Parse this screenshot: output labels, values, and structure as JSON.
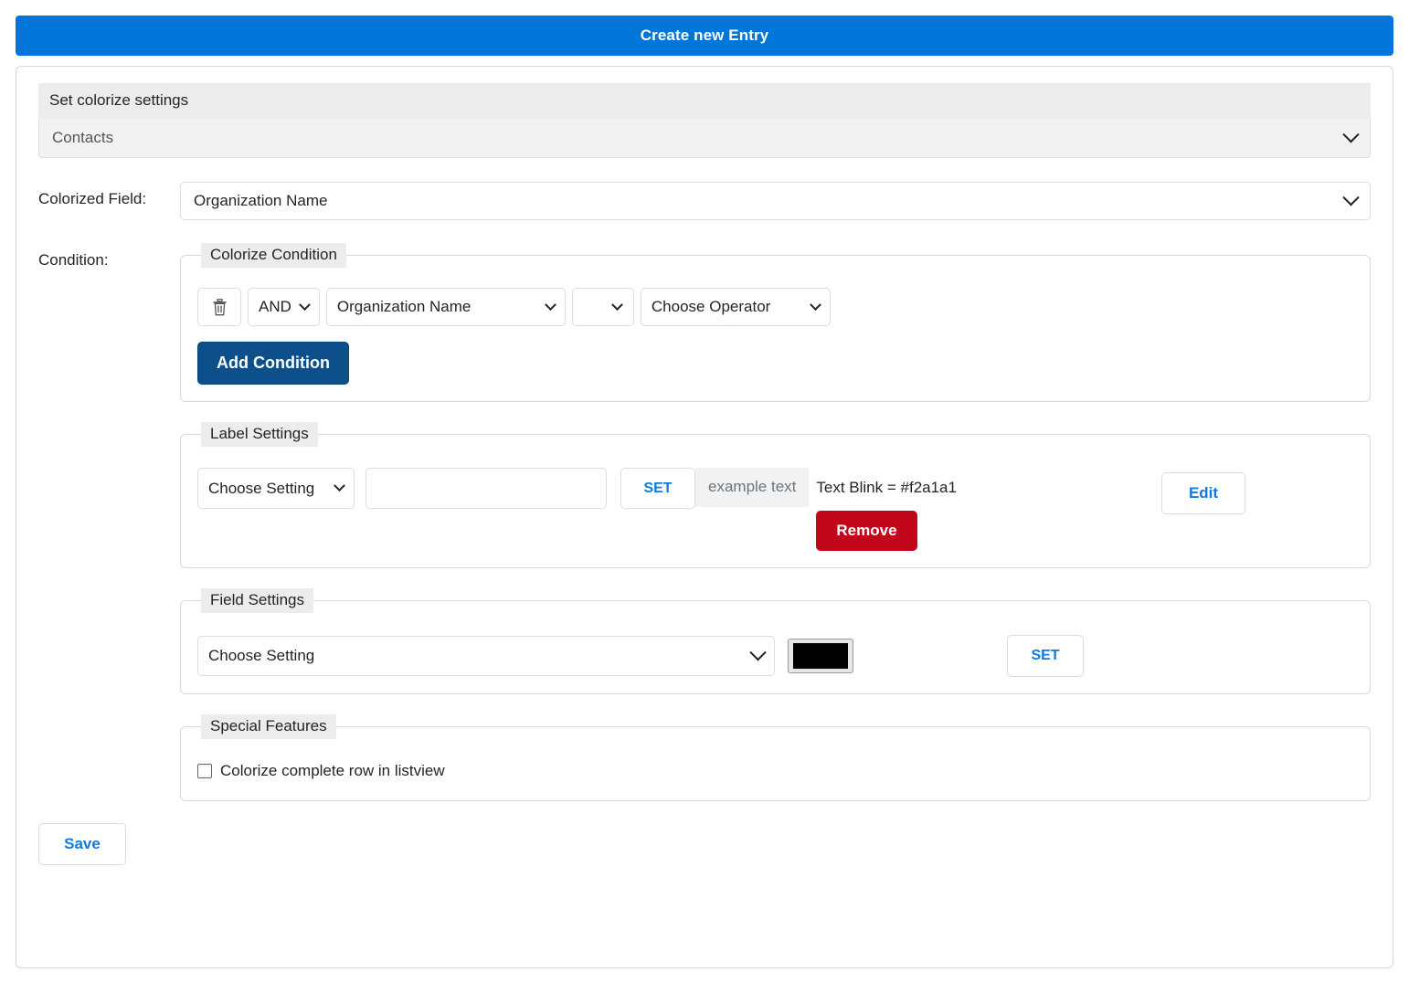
{
  "header": {
    "title": "Create new Entry"
  },
  "module_panel": {
    "heading": "Set colorize settings",
    "selected_module": "Contacts"
  },
  "colorized_field": {
    "label": "Colorized Field:",
    "value": "Organization Name"
  },
  "condition": {
    "label": "Condition:",
    "legend": "Colorize Condition",
    "row": {
      "delete_icon": "trash-icon",
      "logic": "AND",
      "field": "Organization Name",
      "subfield": "",
      "operator": "Choose Operator"
    },
    "add_button": "Add Condition"
  },
  "label_settings": {
    "legend": "Label Settings",
    "setting_select": "Choose Setting",
    "value_input": "",
    "value_placeholder": "",
    "set_button": "SET",
    "example_text": "example text",
    "applied_rule": "Text Blink = #f2a1a1",
    "remove_button": "Remove",
    "edit_button": "Edit"
  },
  "field_settings": {
    "legend": "Field Settings",
    "setting_select": "Choose Setting",
    "color_value": "#000000",
    "set_button": "SET"
  },
  "special_features": {
    "legend": "Special Features",
    "checkbox_label": "Colorize complete row in listview",
    "checked": false
  },
  "footer": {
    "save_button": "Save"
  },
  "colors": {
    "header_blue": "#0275d8",
    "primary_dark_blue": "#0d4f8b",
    "danger_red": "#c2071b",
    "link_blue": "#0d7ae5",
    "panel_grey": "#ececec",
    "blink_color": "#f2a1a1"
  }
}
